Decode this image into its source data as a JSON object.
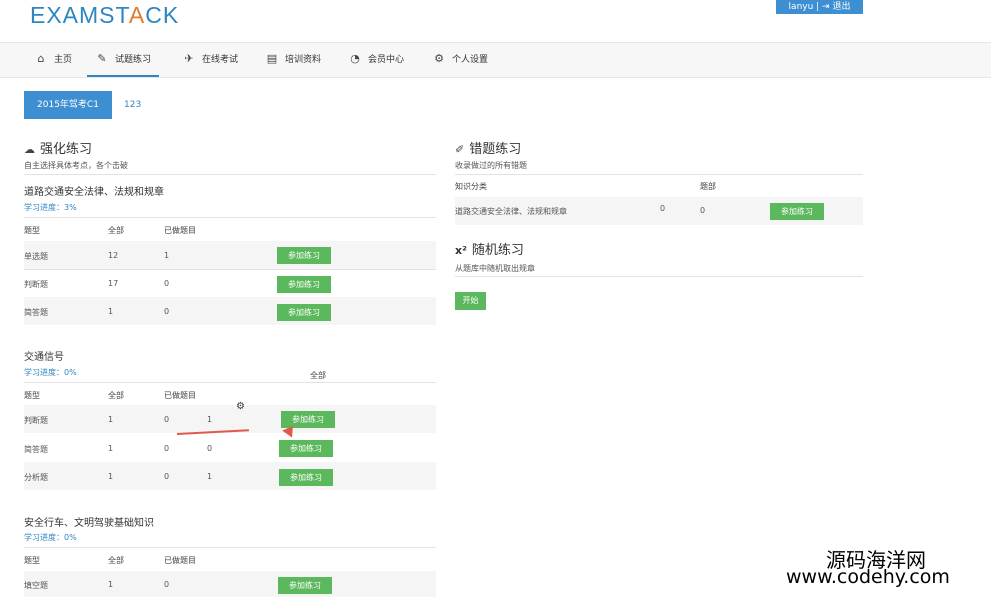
{
  "header": {
    "logo_main": "EXAMST",
    "logo_accent": "A",
    "logo_rest": "CK",
    "user": "lanyu | ⇥ 退出"
  },
  "nav": {
    "items": [
      {
        "icon": "home-icon",
        "glyph": "⌂",
        "label": "主页"
      },
      {
        "icon": "edit-icon",
        "glyph": "✎",
        "label": "试题练习"
      },
      {
        "icon": "paper-plane-icon",
        "glyph": "✈",
        "label": "在线考试"
      },
      {
        "icon": "book-icon",
        "glyph": "▤",
        "label": "培训资料"
      },
      {
        "icon": "dashboard-icon",
        "glyph": "◔",
        "label": "会员中心"
      },
      {
        "icon": "cogs-icon",
        "glyph": "⚙",
        "label": "个人设置"
      }
    ]
  },
  "subjects": {
    "active": "2015年驾考C1",
    "other": "123"
  },
  "strengthen": {
    "icon": "cloud-icon",
    "title": "强化练习",
    "desc": "自主选择具体考点，各个击破",
    "col_type": "题型",
    "col_total": "全部",
    "col_done": "已做题目",
    "button": "参加练习",
    "groups": [
      {
        "title": "道路交通安全法律、法规和规章",
        "progress": "学习进度：3%",
        "rows": [
          {
            "type": "单选题",
            "total": "12",
            "done": "1"
          },
          {
            "type": "判断题",
            "total": "17",
            "done": "0"
          },
          {
            "type": "简答题",
            "total": "1",
            "done": "0"
          }
        ]
      },
      {
        "title": "交通信号",
        "progress": "学习进度：0%",
        "floating_label": "全部",
        "rows": [
          {
            "type": "判断题",
            "total": "1",
            "done": "0",
            "extra": "1"
          },
          {
            "type": "简答题",
            "total": "1",
            "done": "0",
            "extra": "0"
          },
          {
            "type": "分析题",
            "total": "1",
            "done": "0",
            "extra": "1"
          }
        ]
      },
      {
        "title": "安全行车、文明驾驶基础知识",
        "progress": "学习进度：0%",
        "rows": [
          {
            "type": "填空题",
            "total": "1",
            "done": "0"
          }
        ]
      }
    ]
  },
  "wrong": {
    "icon": "eraser-icon",
    "title": "错题练习",
    "desc": "收录做过的所有错题",
    "col_category": "知识分类",
    "col_total": "题部",
    "row": {
      "category": "道路交通安全法律、法规和规章",
      "mark": "0",
      "total": "0"
    },
    "button": "参加练习"
  },
  "random": {
    "icon_prefix": "x²",
    "title": "随机练习",
    "desc": "从题库中随机取出规章",
    "button": "开始"
  },
  "watermark": {
    "line1": "源码海洋网",
    "line2": "www.codehy.com"
  }
}
